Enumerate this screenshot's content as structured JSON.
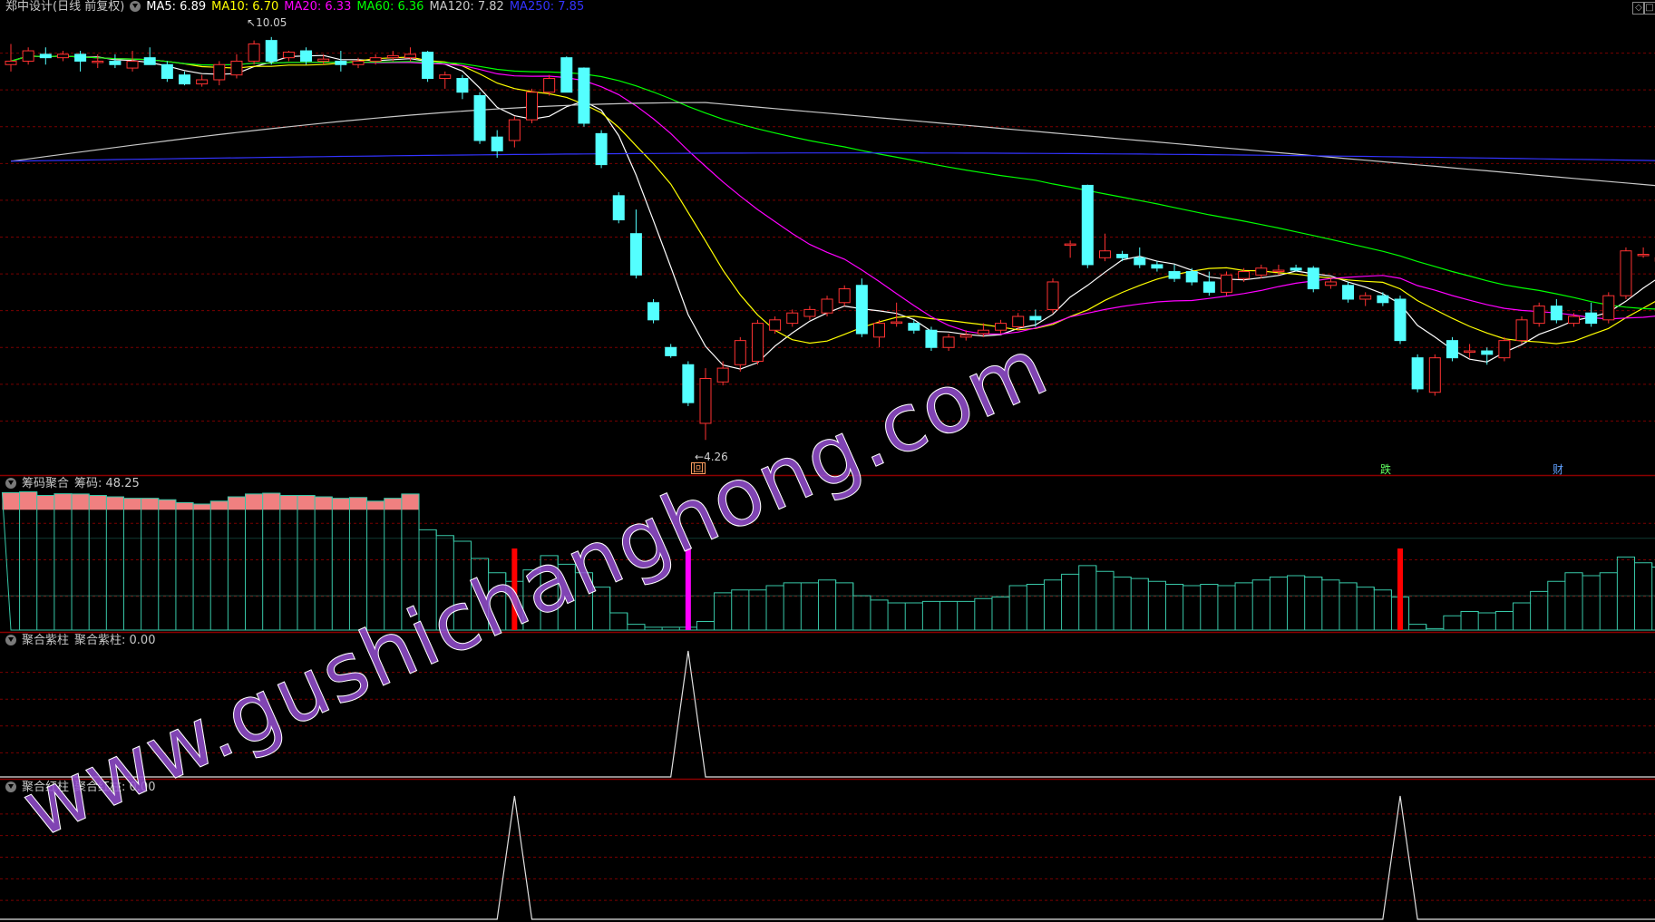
{
  "main_panel": {
    "title": "郑中设计(日线 前复权)",
    "ma_labels": [
      {
        "text": "MA5: 6.89",
        "color": "#ffffff"
      },
      {
        "text": "MA10: 6.70",
        "color": "#ffff00"
      },
      {
        "text": "MA20: 6.33",
        "color": "#ff00ff"
      },
      {
        "text": "MA60: 6.36",
        "color": "#00ff00"
      },
      {
        "text": "MA120: 7.82",
        "color": "#c8c8c8"
      },
      {
        "text": "MA250: 7.85",
        "color": "#3333ff"
      }
    ],
    "high_label": "10.05",
    "low_label": "4.26",
    "marker_1": "回",
    "marker_2": "跌",
    "marker_3": "财"
  },
  "panel_chips": {
    "title": "筹码聚合",
    "value_label": "筹码: 48.25"
  },
  "panel_purple": {
    "title": "聚合紫柱",
    "value_label": "聚合紫柱: 0.00"
  },
  "panel_red": {
    "title": "聚合红柱",
    "value_label": "聚合红柱: 0.00"
  },
  "watermark": "www.gushichanghong.com",
  "colors": {
    "up": "#ff3232",
    "down": "#54ffff",
    "grid": "#7a0000",
    "divider": "#8b0000",
    "ma5": "#ffffff",
    "ma10": "#ffff00",
    "ma20": "#ff00ff",
    "ma60": "#00ff00",
    "ma120": "#c8c8c8",
    "ma250": "#3333ff",
    "chip_fill": "#f08080",
    "chip_line": "#38c8a8",
    "purple_bar": "#ff00ff",
    "red_bar": "#ff0000"
  },
  "chart_data": {
    "type": "candlestick",
    "ylim": [
      4.0,
      10.4
    ],
    "candles": [
      {
        "o": 9.7,
        "h": 10.0,
        "l": 9.6,
        "c": 9.75
      },
      {
        "o": 9.75,
        "h": 9.95,
        "l": 9.7,
        "c": 9.9
      },
      {
        "o": 9.85,
        "h": 9.95,
        "l": 9.7,
        "c": 9.8
      },
      {
        "o": 9.8,
        "h": 9.9,
        "l": 9.75,
        "c": 9.85
      },
      {
        "o": 9.85,
        "h": 9.9,
        "l": 9.6,
        "c": 9.75
      },
      {
        "o": 9.75,
        "h": 9.85,
        "l": 9.65,
        "c": 9.75
      },
      {
        "o": 9.75,
        "h": 9.85,
        "l": 9.65,
        "c": 9.7
      },
      {
        "o": 9.65,
        "h": 9.9,
        "l": 9.6,
        "c": 9.75
      },
      {
        "o": 9.8,
        "h": 9.95,
        "l": 9.7,
        "c": 9.7
      },
      {
        "o": 9.7,
        "h": 9.75,
        "l": 9.45,
        "c": 9.5
      },
      {
        "o": 9.55,
        "h": 9.6,
        "l": 9.4,
        "c": 9.42
      },
      {
        "o": 9.42,
        "h": 9.55,
        "l": 9.38,
        "c": 9.48
      },
      {
        "o": 9.48,
        "h": 9.75,
        "l": 9.4,
        "c": 9.7
      },
      {
        "o": 9.55,
        "h": 9.85,
        "l": 9.5,
        "c": 9.75
      },
      {
        "o": 9.75,
        "h": 10.05,
        "l": 9.7,
        "c": 10.0
      },
      {
        "o": 10.05,
        "h": 10.1,
        "l": 9.7,
        "c": 9.75
      },
      {
        "o": 9.8,
        "h": 9.9,
        "l": 9.75,
        "c": 9.88
      },
      {
        "o": 9.9,
        "h": 9.95,
        "l": 9.7,
        "c": 9.75
      },
      {
        "o": 9.75,
        "h": 9.85,
        "l": 9.7,
        "c": 9.78
      },
      {
        "o": 9.75,
        "h": 9.9,
        "l": 9.6,
        "c": 9.7
      },
      {
        "o": 9.7,
        "h": 9.8,
        "l": 9.65,
        "c": 9.75
      },
      {
        "o": 9.75,
        "h": 9.85,
        "l": 9.7,
        "c": 9.8
      },
      {
        "o": 9.8,
        "h": 9.9,
        "l": 9.75,
        "c": 9.83
      },
      {
        "o": 9.8,
        "h": 9.95,
        "l": 9.75,
        "c": 9.85
      },
      {
        "o": 9.88,
        "h": 9.9,
        "l": 9.45,
        "c": 9.5
      },
      {
        "o": 9.5,
        "h": 9.6,
        "l": 9.35,
        "c": 9.55
      },
      {
        "o": 9.5,
        "h": 9.55,
        "l": 9.2,
        "c": 9.3
      },
      {
        "o": 9.25,
        "h": 9.3,
        "l": 8.55,
        "c": 8.6
      },
      {
        "o": 8.65,
        "h": 8.75,
        "l": 8.35,
        "c": 8.45
      },
      {
        "o": 8.6,
        "h": 8.95,
        "l": 8.5,
        "c": 8.9
      },
      {
        "o": 8.9,
        "h": 9.35,
        "l": 8.85,
        "c": 9.3
      },
      {
        "o": 9.3,
        "h": 9.55,
        "l": 9.25,
        "c": 9.5
      },
      {
        "o": 9.8,
        "h": 9.82,
        "l": 9.3,
        "c": 9.3
      },
      {
        "o": 9.65,
        "h": 9.66,
        "l": 8.8,
        "c": 8.85
      },
      {
        "o": 8.7,
        "h": 8.75,
        "l": 8.2,
        "c": 8.25
      },
      {
        "o": 7.8,
        "h": 7.85,
        "l": 7.4,
        "c": 7.45
      },
      {
        "o": 7.25,
        "h": 7.6,
        "l": 6.6,
        "c": 6.65
      },
      {
        "o": 6.25,
        "h": 6.3,
        "l": 5.95,
        "c": 6.0
      },
      {
        "o": 5.6,
        "h": 5.65,
        "l": 5.45,
        "c": 5.48
      },
      {
        "o": 5.35,
        "h": 5.4,
        "l": 4.75,
        "c": 4.8
      },
      {
        "o": 4.5,
        "h": 5.3,
        "l": 4.26,
        "c": 5.15
      },
      {
        "o": 5.1,
        "h": 5.4,
        "l": 5.05,
        "c": 5.3
      },
      {
        "o": 5.35,
        "h": 5.75,
        "l": 5.25,
        "c": 5.7
      },
      {
        "o": 5.4,
        "h": 6.0,
        "l": 5.35,
        "c": 5.95
      },
      {
        "o": 5.85,
        "h": 6.05,
        "l": 5.8,
        "c": 6.0
      },
      {
        "o": 5.95,
        "h": 6.15,
        "l": 5.9,
        "c": 6.1
      },
      {
        "o": 6.05,
        "h": 6.2,
        "l": 6.0,
        "c": 6.15
      },
      {
        "o": 6.1,
        "h": 6.35,
        "l": 6.05,
        "c": 6.3
      },
      {
        "o": 6.25,
        "h": 6.5,
        "l": 6.2,
        "c": 6.45
      },
      {
        "o": 6.5,
        "h": 6.6,
        "l": 5.75,
        "c": 5.8
      },
      {
        "o": 5.75,
        "h": 6.0,
        "l": 5.6,
        "c": 5.95
      },
      {
        "o": 5.95,
        "h": 6.25,
        "l": 5.9,
        "c": 5.97
      },
      {
        "o": 5.95,
        "h": 6.0,
        "l": 5.8,
        "c": 5.85
      },
      {
        "o": 5.85,
        "h": 5.9,
        "l": 5.55,
        "c": 5.6
      },
      {
        "o": 5.6,
        "h": 5.8,
        "l": 5.55,
        "c": 5.75
      },
      {
        "o": 5.75,
        "h": 5.85,
        "l": 5.7,
        "c": 5.78
      },
      {
        "o": 5.8,
        "h": 5.95,
        "l": 5.75,
        "c": 5.85
      },
      {
        "o": 5.85,
        "h": 6.0,
        "l": 5.8,
        "c": 5.95
      },
      {
        "o": 5.9,
        "h": 6.1,
        "l": 5.85,
        "c": 6.05
      },
      {
        "o": 6.05,
        "h": 6.15,
        "l": 5.9,
        "c": 6.0
      },
      {
        "o": 6.15,
        "h": 6.6,
        "l": 6.1,
        "c": 6.55
      },
      {
        "o": 7.1,
        "h": 7.15,
        "l": 6.9,
        "c": 7.1
      },
      {
        "o": 7.95,
        "h": 7.96,
        "l": 6.75,
        "c": 6.8
      },
      {
        "o": 6.9,
        "h": 7.25,
        "l": 6.85,
        "c": 7.0
      },
      {
        "o": 6.95,
        "h": 7.0,
        "l": 6.85,
        "c": 6.9
      },
      {
        "o": 6.9,
        "h": 7.05,
        "l": 6.75,
        "c": 6.8
      },
      {
        "o": 6.8,
        "h": 6.85,
        "l": 6.7,
        "c": 6.75
      },
      {
        "o": 6.7,
        "h": 6.8,
        "l": 6.55,
        "c": 6.6
      },
      {
        "o": 6.7,
        "h": 6.75,
        "l": 6.5,
        "c": 6.55
      },
      {
        "o": 6.55,
        "h": 6.7,
        "l": 6.35,
        "c": 6.4
      },
      {
        "o": 6.4,
        "h": 6.7,
        "l": 6.35,
        "c": 6.65
      },
      {
        "o": 6.6,
        "h": 6.75,
        "l": 6.55,
        "c": 6.7
      },
      {
        "o": 6.65,
        "h": 6.8,
        "l": 6.6,
        "c": 6.75
      },
      {
        "o": 6.7,
        "h": 6.8,
        "l": 6.65,
        "c": 6.72
      },
      {
        "o": 6.75,
        "h": 6.8,
        "l": 6.7,
        "c": 6.72
      },
      {
        "o": 6.75,
        "h": 6.78,
        "l": 6.4,
        "c": 6.45
      },
      {
        "o": 6.5,
        "h": 6.6,
        "l": 6.45,
        "c": 6.55
      },
      {
        "o": 6.5,
        "h": 6.55,
        "l": 6.25,
        "c": 6.3
      },
      {
        "o": 6.3,
        "h": 6.4,
        "l": 6.2,
        "c": 6.35
      },
      {
        "o": 6.35,
        "h": 6.4,
        "l": 6.2,
        "c": 6.25
      },
      {
        "o": 6.3,
        "h": 6.35,
        "l": 5.65,
        "c": 5.7
      },
      {
        "o": 5.45,
        "h": 5.5,
        "l": 4.95,
        "c": 5.0
      },
      {
        "o": 4.95,
        "h": 5.5,
        "l": 4.9,
        "c": 5.45
      },
      {
        "o": 5.7,
        "h": 5.75,
        "l": 5.4,
        "c": 5.45
      },
      {
        "o": 5.55,
        "h": 5.65,
        "l": 5.45,
        "c": 5.55
      },
      {
        "o": 5.55,
        "h": 5.6,
        "l": 5.35,
        "c": 5.5
      },
      {
        "o": 5.45,
        "h": 5.75,
        "l": 5.4,
        "c": 5.7
      },
      {
        "o": 5.7,
        "h": 6.05,
        "l": 5.65,
        "c": 6.0
      },
      {
        "o": 5.95,
        "h": 6.25,
        "l": 5.9,
        "c": 6.2
      },
      {
        "o": 6.2,
        "h": 6.3,
        "l": 5.95,
        "c": 6.0
      },
      {
        "o": 5.95,
        "h": 6.1,
        "l": 5.9,
        "c": 6.05
      },
      {
        "o": 6.1,
        "h": 6.25,
        "l": 5.9,
        "c": 5.95
      },
      {
        "o": 6.0,
        "h": 6.4,
        "l": 5.95,
        "c": 6.35
      },
      {
        "o": 6.35,
        "h": 7.05,
        "l": 6.3,
        "c": 7.0
      },
      {
        "o": 6.95,
        "h": 7.05,
        "l": 6.9,
        "c": 6.95
      },
      {
        "o": 6.85,
        "h": 6.95,
        "l": 6.8,
        "c": 6.9
      },
      {
        "o": 6.85,
        "h": 6.95,
        "l": 6.75,
        "c": 6.9
      },
      {
        "o": 6.95,
        "h": 7.0,
        "l": 6.85,
        "c": 6.9
      }
    ],
    "chip_values": [
      48.0,
      48.25,
      47.0,
      47.6,
      47.5,
      47.0,
      46.5,
      46.0,
      46.0,
      45.5,
      44.5,
      44.0,
      45.0,
      46.5,
      47.5,
      47.8,
      47.0,
      47.0,
      46.5,
      46.0,
      46.3,
      45.0,
      46.0,
      47.5,
      35.0,
      33.0,
      31.0,
      25.0,
      20.0,
      17.0,
      21.0,
      26.0,
      23.0,
      20.0,
      15.0,
      6.0,
      2.0,
      1.0,
      1.0,
      1.0,
      3.0,
      13.0,
      14.0,
      14.0,
      15.5,
      16.5,
      16.5,
      17.5,
      16.5,
      12.0,
      10.5,
      9.5,
      9.5,
      10.0,
      10.0,
      10.0,
      11.0,
      11.5,
      15.5,
      16.0,
      17.5,
      19.5,
      22.5,
      20.5,
      18.5,
      18.0,
      17.0,
      16.0,
      15.5,
      16.0,
      15.5,
      16.5,
      17.5,
      18.5,
      19.0,
      18.5,
      17.5,
      16.5,
      15.0,
      14.0,
      11.5,
      2.0,
      0.5,
      5.0,
      6.5,
      6.0,
      6.5,
      9.5,
      13.5,
      17.0,
      20.0,
      19.0,
      20.0,
      25.5,
      23.5,
      22.0,
      20.0,
      19.0
    ],
    "purple_signal_index": 39,
    "red_signal_indices": [
      29,
      80
    ]
  }
}
